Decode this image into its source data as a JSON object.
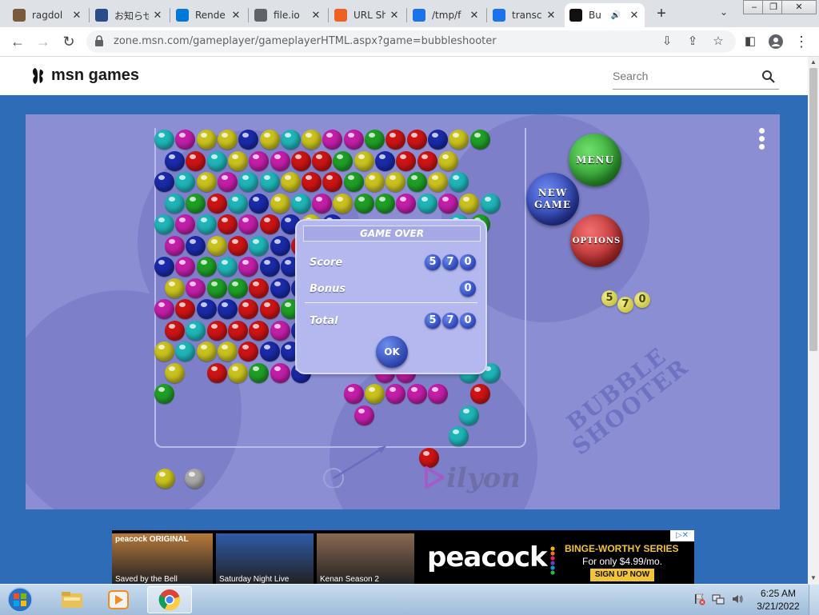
{
  "browser": {
    "tabs": [
      {
        "title": "ragdol",
        "favicon": "cat-photo-icon",
        "color": "#7a5a3c"
      },
      {
        "title": "お知らせ",
        "favicon": "news-icon",
        "color": "#2a4a8a"
      },
      {
        "title": "Rende",
        "favicon": "windows-icon",
        "color": "#0078d7"
      },
      {
        "title": "file.io",
        "favicon": "globe-icon",
        "color": "#5f6368"
      },
      {
        "title": "URL Sh",
        "favicon": "bitly-icon",
        "color": "#ee6123"
      },
      {
        "title": "/tmp/f",
        "favicon": "cloud-upload-icon",
        "color": "#1a73e8"
      },
      {
        "title": "transc",
        "favicon": "cloud-upload-icon",
        "color": "#1a73e8"
      },
      {
        "title": "Bu",
        "favicon": "msn-butterfly-icon",
        "color": "#111111",
        "active": true
      }
    ],
    "new_tab": "+",
    "url": "zone.msn.com/gameplayer/gameplayerHTML.aspx?game=bubbleshooter",
    "window_controls": [
      "–",
      "❐",
      "✕"
    ]
  },
  "site": {
    "logo_text": "msn games",
    "search_placeholder": "Search"
  },
  "game": {
    "name": "BUBBLE SHOOTER",
    "buttons": {
      "menu": "MENU",
      "new_game": "NEW GAME",
      "options": "OPTIONS"
    },
    "side_score_digits": [
      "5",
      "7",
      "0"
    ],
    "brand": "ilyon",
    "colors": {
      "cyan": "#1fb5b8",
      "magenta": "#c21ea8",
      "yellow": "#c9c21e",
      "blue": "#1a2aa8",
      "red": "#cc1414",
      "green": "#1f9e26",
      "gray": "#a9a9a9"
    },
    "next_bubbles": [
      "yellow",
      "gray"
    ],
    "loaded_bubble": "red",
    "dialog": {
      "title": "GAME OVER",
      "score_label": "Score",
      "score_digits": [
        "5",
        "7",
        "0"
      ],
      "bonus_label": "Bonus",
      "bonus_digits": [
        "0"
      ],
      "total_label": "Total",
      "total_digits": [
        "5",
        "7",
        "0"
      ],
      "ok_label": "OK"
    }
  },
  "ad": {
    "tiles": [
      {
        "caption": "Saved by the Bell",
        "tag": "peacock ORIGINAL",
        "bg": "#b87a3a"
      },
      {
        "caption": "Saturday Night Live",
        "tag": "",
        "bg": "#2f5aa8"
      },
      {
        "caption": "Kenan Season 2",
        "tag": "",
        "bg": "#8a6a52"
      }
    ],
    "brand": "peacock",
    "headline": "BINGE-WORTHY SERIES",
    "offer": "For only $4.99/mo.",
    "cta": "SIGN UP NOW",
    "close": "▷✕"
  },
  "taskbar": {
    "apps": [
      "file-explorer-icon",
      "media-player-icon",
      "chrome-icon"
    ],
    "time": "6:25 AM",
    "date": "3/21/2022"
  }
}
